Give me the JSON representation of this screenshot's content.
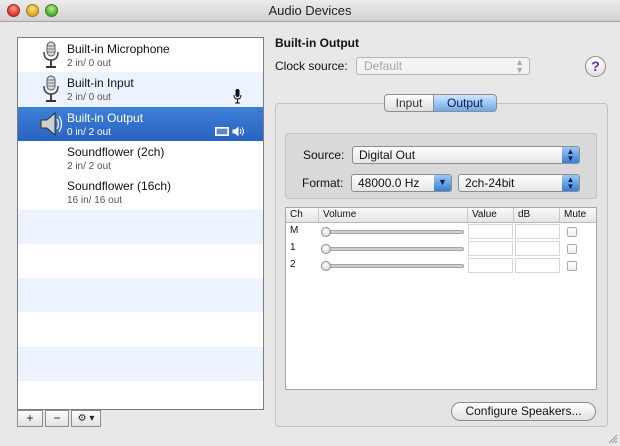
{
  "window": {
    "title": "Audio Devices"
  },
  "devices": [
    {
      "name": "Built-in Microphone",
      "io": "2 in/ 0 out",
      "icon": "microphone-icon",
      "selected": false
    },
    {
      "name": "Built-in Input",
      "io": "2 in/ 0 out",
      "icon": "microphone-icon",
      "selected": false,
      "status_icon": "mic-small-icon"
    },
    {
      "name": "Built-in Output",
      "io": "0 in/ 2 out",
      "icon": "speaker-icon",
      "selected": true,
      "status_icons": [
        "screen-icon",
        "volume-icon"
      ]
    },
    {
      "name": "Soundflower (2ch)",
      "io": "2 in/ 2 out",
      "selected": false
    },
    {
      "name": "Soundflower (16ch)",
      "io": "16 in/ 16 out",
      "selected": false
    }
  ],
  "list_toolbar": {
    "add": "+",
    "remove": "−",
    "action": "⚙ ▾"
  },
  "detail": {
    "heading": "Built-in Output",
    "clock_label": "Clock source:",
    "clock_value": "Default",
    "help": "?",
    "tabs": [
      {
        "label": "Input"
      },
      {
        "label": "Output"
      }
    ],
    "active_tab": "Output",
    "source_label": "Source:",
    "source_value": "Digital Out",
    "format_label": "Format:",
    "format_rate": "48000.0 Hz",
    "format_bits": "2ch-24bit",
    "table": {
      "headers": [
        "Ch",
        "Volume",
        "Value",
        "dB",
        "Mute"
      ],
      "rows": [
        {
          "ch": "M",
          "volume": 0
        },
        {
          "ch": "1",
          "volume": 0
        },
        {
          "ch": "2",
          "volume": 0
        }
      ]
    },
    "configure_button": "Configure Speakers..."
  },
  "colors": {
    "selection": "#2f6fcd",
    "stripe": "#edf3fe",
    "accent": "#3a7fd4"
  }
}
